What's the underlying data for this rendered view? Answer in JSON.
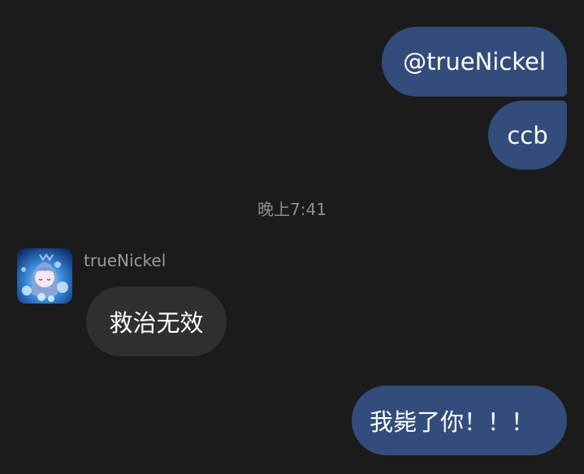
{
  "messages": [
    {
      "text": "@trueNickel",
      "direction": "sent"
    },
    {
      "text": "ccb",
      "direction": "sent"
    },
    {
      "text": "救治无效",
      "direction": "received",
      "sender": "trueNickel"
    },
    {
      "text": "我毙了你！！！",
      "direction": "sent"
    }
  ],
  "timestamp": "晚上7:41",
  "colors": {
    "background": "#1b1b1c",
    "sent_bubble": "#324c7b",
    "received_bubble": "#2f2f2f"
  },
  "icons": {
    "avatar": "anime-character-avatar"
  }
}
